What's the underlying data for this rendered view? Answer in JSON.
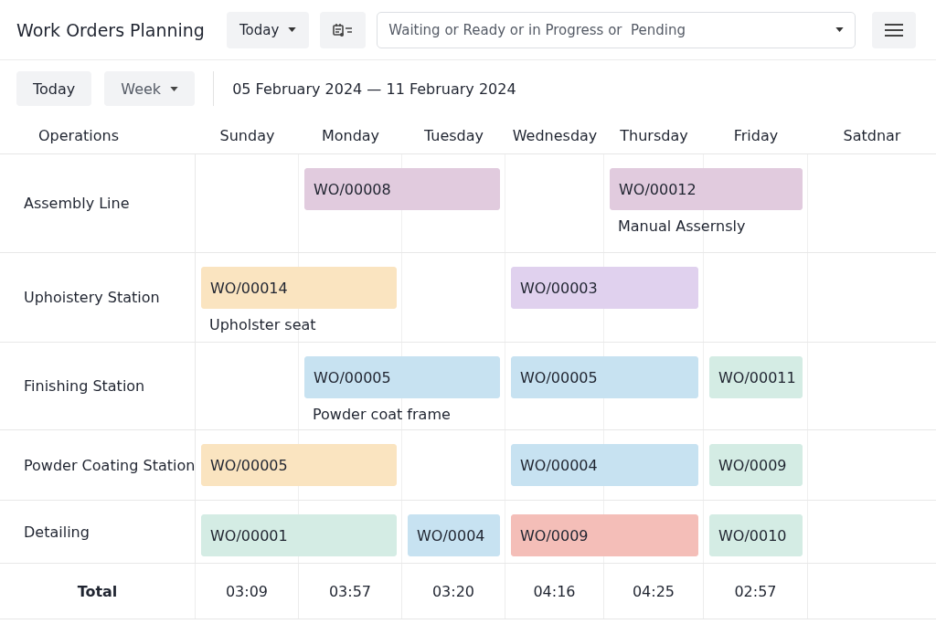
{
  "header": {
    "title": "Work Orders Planning",
    "period_menu": "Today",
    "filter": "Waiting or Ready or in Progress or  Pending"
  },
  "toolbar": {
    "today": "Today",
    "view": "Week",
    "range": "05 February 2024 — 11 February 2024"
  },
  "columns": {
    "operations": "Operations",
    "days": [
      "Sunday",
      "Monday",
      "Tuesday",
      "Wednesday",
      "Thursday",
      "Friday",
      "Satdnar"
    ]
  },
  "rows": [
    {
      "name": "Assembly Line",
      "slots": [
        {
          "kind": "empty"
        },
        {
          "kind": "order",
          "label": "WO/00008",
          "wide": true,
          "color": "#e3cde0"
        },
        {
          "kind": "empty"
        },
        {
          "kind": "order",
          "label": "WO/00012",
          "wide": true,
          "color": "#e3cde0",
          "note": "Manual Assernsly"
        }
      ]
    },
    {
      "name": "Uphoistery Station",
      "slots": [
        {
          "kind": "order",
          "label": "WO/00014",
          "wide": true,
          "color": "#fde6c2",
          "note": "Upholster seat"
        },
        {
          "kind": "empty"
        },
        {
          "kind": "order",
          "label": "WO/00003",
          "wide": true,
          "color": "#e2d3f0"
        }
      ]
    },
    {
      "name": "Finishing Station",
      "slots": [
        {
          "kind": "empty"
        },
        {
          "kind": "order",
          "label": "WO/00005",
          "wide": true,
          "color": "#c9e4f3",
          "note": "Powder coat frame"
        },
        {
          "kind": "order",
          "label": "WO/00005",
          "wide": true,
          "color": "#c9e4f3"
        },
        {
          "kind": "order",
          "label": "WO/00011",
          "wide": false,
          "color": "#d6eee6"
        }
      ]
    },
    {
      "name": "Powder Coating Station",
      "slots": [
        {
          "kind": "order",
          "label": "WO/00005",
          "wide": true,
          "color": "#fde6c2"
        },
        {
          "kind": "empty"
        },
        {
          "kind": "order",
          "label": "WO/00004",
          "wide": true,
          "color": "#c9e4f3"
        },
        {
          "kind": "order",
          "label": "WO/0009",
          "wide": false,
          "color": "#d6eee6"
        }
      ]
    },
    {
      "name": "Detailing",
      "slots": [
        {
          "kind": "order",
          "label": "WO/00001",
          "wide": true,
          "color": "#d6eee6"
        },
        {
          "kind": "order",
          "label": "WO/0004",
          "wide": false,
          "color": "#c9e4f3"
        },
        {
          "kind": "order",
          "label": "WO/0009",
          "wide": true,
          "color": "#f6c0ba"
        },
        {
          "kind": "order",
          "label": "WO/0010",
          "wide": false,
          "color": "#d6eee6"
        }
      ]
    }
  ],
  "total": {
    "label": "Total",
    "values": [
      "03:09",
      "03:57",
      "03:20",
      "04:16",
      "04:25",
      "02:57"
    ]
  }
}
